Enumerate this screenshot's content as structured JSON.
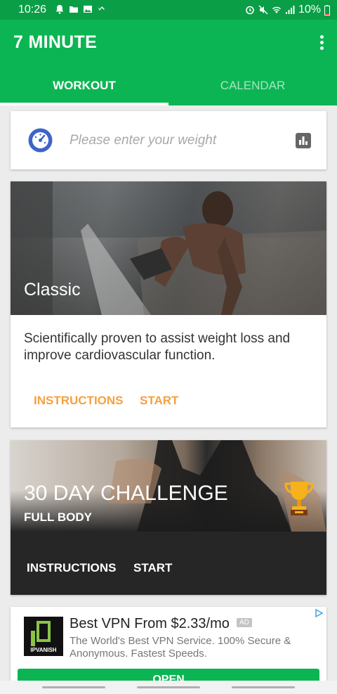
{
  "status_bar": {
    "time": "10:26",
    "battery": "10%"
  },
  "app_bar": {
    "title": "7 MINUTE"
  },
  "tabs": [
    {
      "label": "WORKOUT",
      "active": true
    },
    {
      "label": "CALENDAR",
      "active": false
    }
  ],
  "weight": {
    "placeholder": "Please enter your weight"
  },
  "classic": {
    "title": "Classic",
    "description": "Scientifically proven to assist weight loss and improve cardiovascular function.",
    "instructions_label": "INSTRUCTIONS",
    "start_label": "START"
  },
  "challenge": {
    "title": "30 DAY CHALLENGE",
    "subtitle": "FULL BODY",
    "instructions_label": "INSTRUCTIONS",
    "start_label": "START"
  },
  "ad": {
    "title": "Best VPN From $2.33/mo",
    "badge": "AD",
    "description": "The World's Best VPN Service. 100% Secure & Anonymous. Fastest Speeds.",
    "button_label": "OPEN",
    "logo_text": "IPVANISH"
  },
  "colors": {
    "primary": "#0cb553",
    "status_bar": "#0a9e46",
    "accent": "#f5a040"
  }
}
